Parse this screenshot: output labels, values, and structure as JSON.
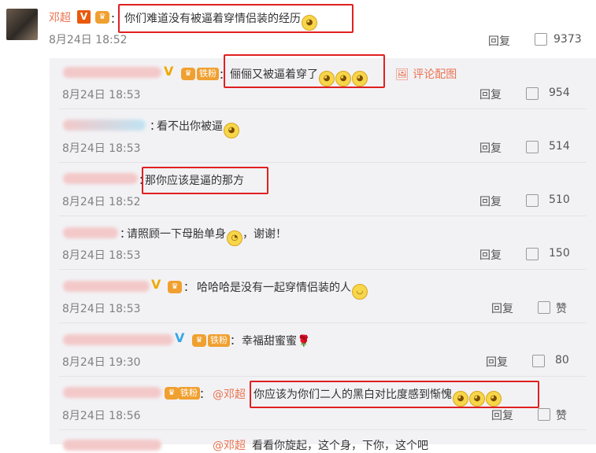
{
  "main_comment": {
    "name": "邓超",
    "v": "V",
    "content": "你们难道没有被逼着穿情侣装的经历",
    "date": "8月24日 18:52",
    "reply": "回复",
    "likes": "9373"
  },
  "replies": [
    {
      "content": "俪俪又被逼着穿了",
      "date": "8月24日 18:53",
      "reply": "回复",
      "likes": "954",
      "fan": "铁粉",
      "img_link": "评论配图"
    },
    {
      "content": "看不出你被逼",
      "date": "8月24日 18:53",
      "reply": "回复",
      "likes": "514"
    },
    {
      "content": "那你应该是逼的那方",
      "date": "8月24日 18:52",
      "reply": "回复",
      "likes": "510"
    },
    {
      "content": "请照顾一下母胎单身",
      "content2": "，谢谢！",
      "date": "8月24日 18:53",
      "reply": "回复",
      "likes": "150"
    },
    {
      "content": "哈哈哈是没有一起穿情侣装的人",
      "date": "8月24日 18:53",
      "reply": "回复",
      "likes": "赞"
    },
    {
      "content": "幸福甜蜜蜜",
      "date": "8月24日 19:30",
      "reply": "回复",
      "likes": "80",
      "fan": "铁粉"
    },
    {
      "content": "你应该为你们二人的黑白对比度感到惭愧",
      "mention": "@邓超",
      "date": "8月24日 18:56",
      "reply": "回复",
      "likes": "赞",
      "fan": "铁粉"
    },
    {
      "mention": "@邓超",
      "content": "看看你旋起，这个身，下你，这个吧"
    }
  ]
}
